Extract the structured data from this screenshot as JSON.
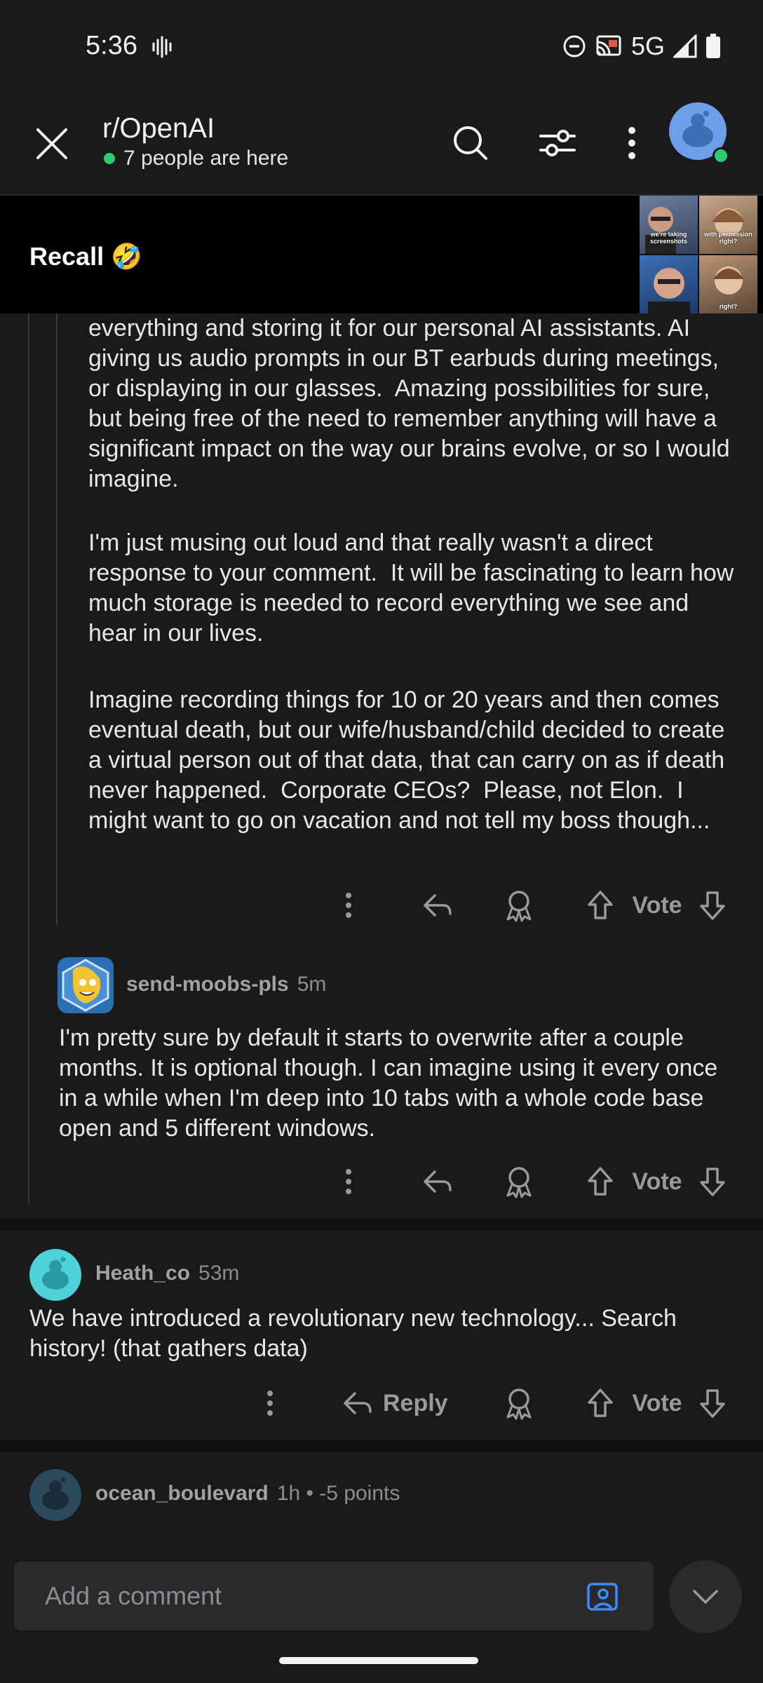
{
  "status_bar": {
    "time": "5:36",
    "network": "5G"
  },
  "header": {
    "title": "r/OpenAI",
    "presence": "7 people are here",
    "colors": {
      "online": "#2ecc71"
    }
  },
  "banner": {
    "title": "Recall 🤣",
    "thumb_captions": [
      "we're taking screenshots",
      "with permission right?",
      "",
      "right?"
    ]
  },
  "thread": {
    "continued_comment": {
      "paragraphs": [
        "everything and storing it for our personal AI assistants. AI giving us audio prompts in our BT earbuds during meetings, or displaying in our glasses.  Amazing possibilities for sure, but being free of the need to remember anything will have a significant impact on the way our brains evolve, or so I would imagine.",
        "I'm just musing out loud and that really wasn't a direct response to your comment.  It will be fascinating to learn how much storage is needed to record everything we see and hear in our lives.",
        "Imagine recording things for 10 or 20 years and then comes eventual death, but our wife/husband/child decided to create a virtual person out of that data, that can carry on as if death never happened.  Corporate CEOs?  Please, not Elon.  I might want to go on vacation and not tell my boss though..."
      ],
      "vote_label": "Vote"
    },
    "reply_comment": {
      "author": "send-moobs-pls",
      "age": "5m",
      "body": "I'm pretty sure by default it starts to overwrite after a couple months. It is optional though. I can imagine using it every once in a while when I'm deep into 10 tabs with a whole code base open and 5 different windows.",
      "vote_label": "Vote"
    },
    "top_comment": {
      "author": "Heath_co",
      "age": "53m",
      "body": "We have introduced a revolutionary new technology... Search history! (that gathers data)",
      "reply_label": "Reply",
      "vote_label": "Vote"
    },
    "next_comment": {
      "author": "ocean_boulevard",
      "meta": "1h • -5 points"
    }
  },
  "composer": {
    "placeholder": "Add a comment",
    "colors": {
      "image_icon": "#3d8bfd"
    }
  }
}
